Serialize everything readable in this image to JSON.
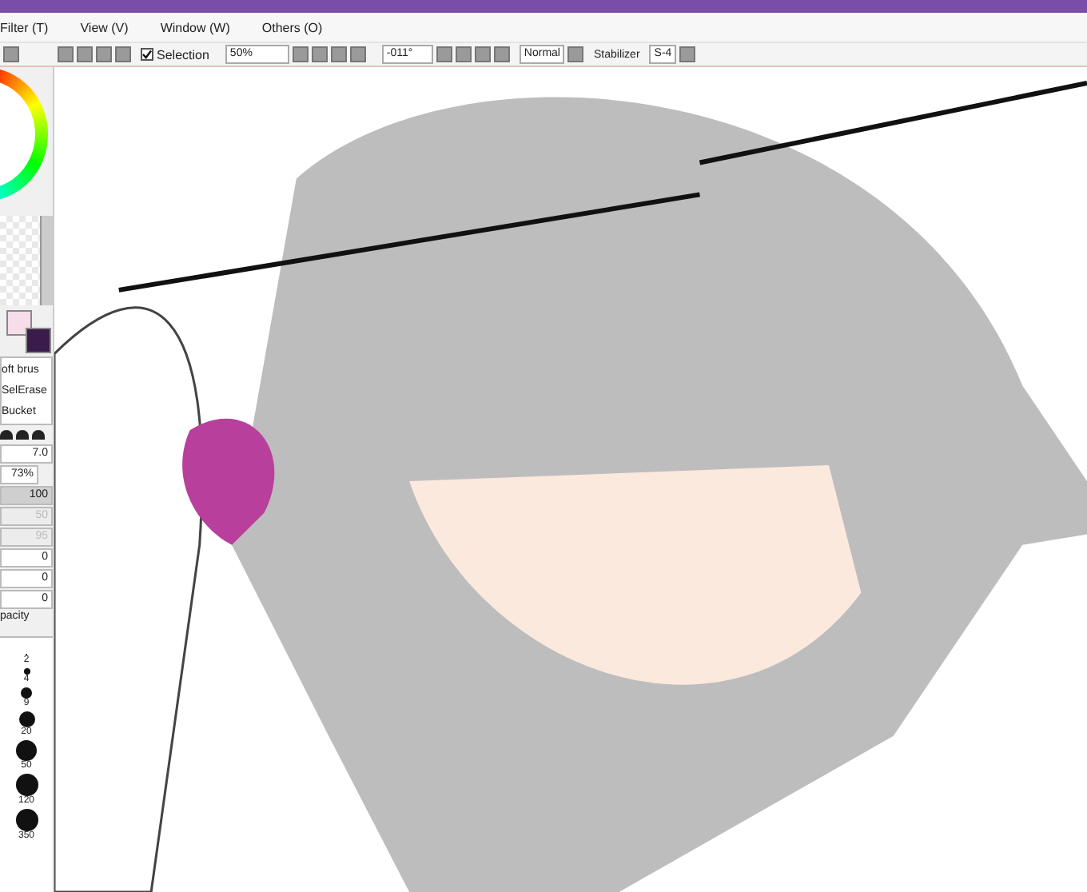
{
  "menu": [
    "Filter (T)",
    "View (V)",
    "Window (W)",
    "Others (O)"
  ],
  "toolbar": {
    "selection": {
      "label": "Selection",
      "checked": true
    },
    "zoom": "50%",
    "angle": "-011°",
    "blend_mode": "Normal",
    "stabilizer": {
      "label": "Stabilizer",
      "value": "S-4"
    }
  },
  "swatches": [
    {
      "color": "#f6dde9"
    },
    {
      "color": "#3b1b4c"
    }
  ],
  "tools": [
    "oft brus",
    "SelErase",
    "Bucket"
  ],
  "brush": {
    "size": "7.0",
    "min_size": "73%",
    "sliders": [
      {
        "value": "100",
        "disabled": false
      },
      {
        "value": "50",
        "disabled": true
      },
      {
        "value": "95",
        "disabled": true
      }
    ],
    "fields": [
      "0",
      "0",
      "0"
    ],
    "opacity_label": "pacity",
    "sizes": [
      "2",
      "4",
      "9",
      "20",
      "50",
      "120",
      "350"
    ]
  }
}
